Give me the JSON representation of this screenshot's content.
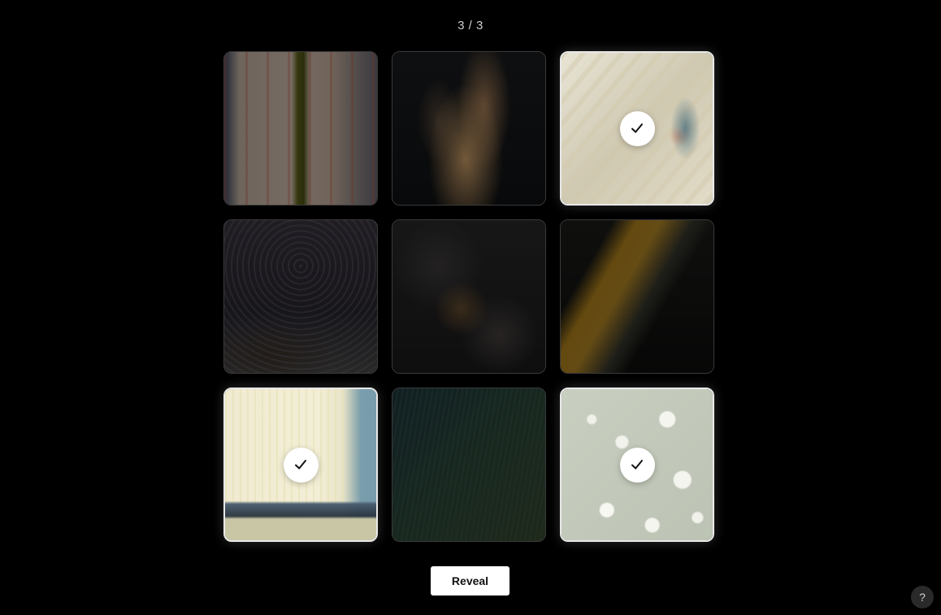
{
  "header": {
    "counter": "3 / 3"
  },
  "grid": {
    "tiles": [
      {
        "id": "tile-1",
        "selected": false,
        "texture": "pink-striped-fabric"
      },
      {
        "id": "tile-2",
        "selected": false,
        "texture": "dark-smoke"
      },
      {
        "id": "tile-3",
        "selected": true,
        "texture": "cream-paint-swirl"
      },
      {
        "id": "tile-4",
        "selected": false,
        "texture": "dark-spiral"
      },
      {
        "id": "tile-5",
        "selected": false,
        "texture": "dark-bubbles"
      },
      {
        "id": "tile-6",
        "selected": false,
        "texture": "yellow-stream-on-black"
      },
      {
        "id": "tile-7",
        "selected": true,
        "texture": "pale-streaks-seashore"
      },
      {
        "id": "tile-8",
        "selected": false,
        "texture": "blue-green-blur"
      },
      {
        "id": "tile-9",
        "selected": true,
        "texture": "water-droplets"
      }
    ]
  },
  "actions": {
    "reveal_label": "Reveal"
  },
  "help": {
    "label": "?"
  },
  "icons": {
    "check": "checkmark-icon",
    "help": "question-icon"
  },
  "colors": {
    "background": "#000000",
    "button_bg": "#ffffff",
    "selected_border": "#e8e8e8"
  }
}
